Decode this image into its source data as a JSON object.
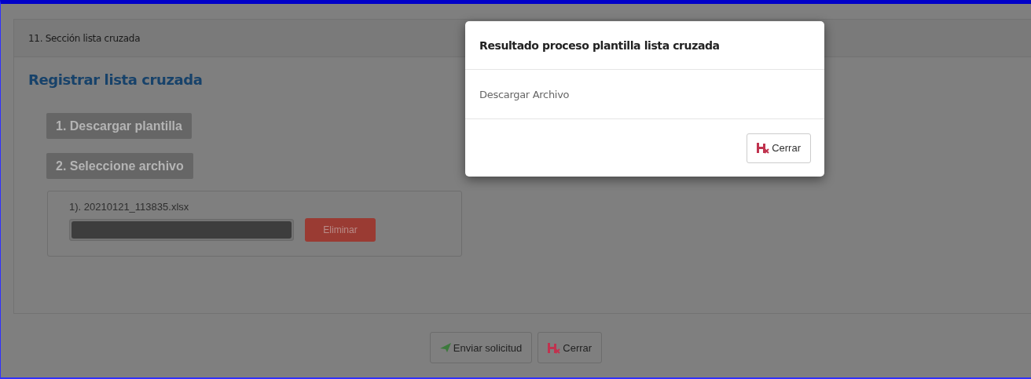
{
  "section": {
    "header": "11. Sección lista cruzada",
    "title": "Registrar lista cruzada",
    "steps": [
      {
        "label": "1. Descargar plantilla"
      },
      {
        "label": "2. Seleccione archivo"
      }
    ],
    "files": [
      {
        "name": "1). 20210121_113835.xlsx",
        "level": 1,
        "remove_label": "Eliminar"
      }
    ]
  },
  "footer_buttons": [
    {
      "label": "Enviar solicitud",
      "kind": "send"
    },
    {
      "label": "Cerrar",
      "kind": "close"
    }
  ],
  "modal": {
    "title": "Resultado proceso plantilla lista cruzada",
    "body": "Descargar Archivo",
    "button": {
      "label": "Cerrar",
      "kind": "close"
    }
  }
}
